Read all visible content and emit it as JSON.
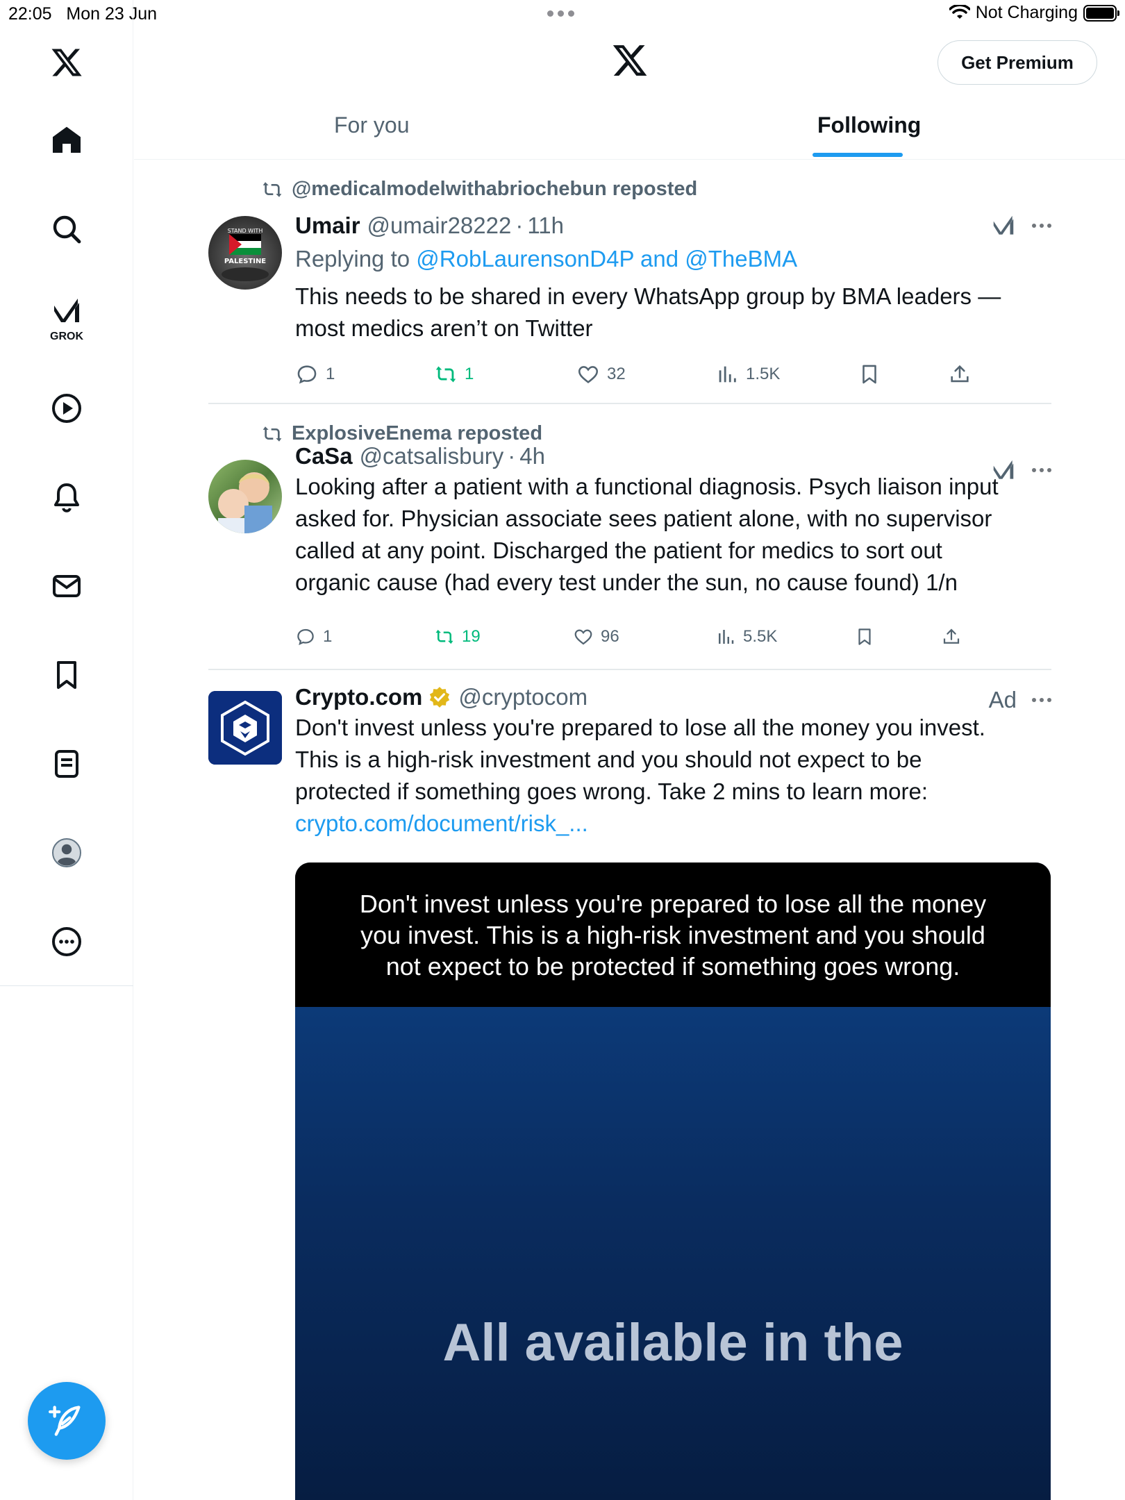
{
  "status_bar": {
    "time": "22:05",
    "date": "Mon 23 Jun",
    "charging": "Not Charging"
  },
  "sidebar": {
    "grok_label": "GROK",
    "icons": [
      "x-logo-icon",
      "home-icon",
      "search-icon",
      "grok-icon",
      "video-icon",
      "notifications-icon",
      "messages-icon",
      "bookmarks-icon",
      "lists-icon",
      "profile-icon",
      "more-icon",
      "compose-icon"
    ]
  },
  "header": {
    "premium_label": "Get Premium",
    "tabs": [
      "For you",
      "Following"
    ],
    "active_tab": "Following"
  },
  "colors": {
    "accent": "#1d9bf0",
    "repost_green": "#00ba7c",
    "text": "#0f1419",
    "muted": "#536471"
  },
  "posts": [
    {
      "repost_by": "@medicalmodelwithabriochebun reposted",
      "name": "Umair",
      "handle": "@umair28222",
      "dot": "·",
      "time": "11h",
      "reply_prefix": "Replying to",
      "reply_mentions": "@RobLaurensonD4P and @TheBMA",
      "text_line1": "This needs to be shared in every WhatsApp group by BMA leaders —",
      "text_line2": "most medics aren’t on Twitter",
      "avatar_text_top": "STAND WITH",
      "avatar_text_bottom": "PALESTINE",
      "stats": {
        "replies": "1",
        "reposts": "1",
        "likes": "32",
        "views": "1.5K"
      }
    },
    {
      "repost_by": "ExplosiveEnema reposted",
      "name": "CaSa",
      "handle": "@catsalisbury",
      "dot": "·",
      "time": "4h",
      "text_line1": "Looking after a patient with a functional diagnosis. Psych liaison input",
      "text_line2": "asked for. Physician associate sees patient alone, with no supervisor",
      "text_line3": "called at any point. Discharged the patient for medics to sort out",
      "text_line4": "organic cause (had every test under the sun, no cause found) 1/n",
      "stats": {
        "replies": "1",
        "reposts": "19",
        "likes": "96",
        "views": "5.5K"
      }
    },
    {
      "name": "Crypto.com",
      "handle": "@cryptocom",
      "ad_label": "Ad",
      "text_line1": "Don't invest unless you're prepared to lose all the money you invest.",
      "text_line2": "This is a high-risk investment and you should not expect to be",
      "text_line3": "protected if something goes wrong. Take 2 mins to learn more:",
      "link": "crypto.com/document/risk_...",
      "media": {
        "top_text_line1": "Don't invest unless you're prepared to lose all the money",
        "top_text_line2": "you invest. This is a high-risk investment and you should",
        "top_text_line3": "not expect to be protected if something goes wrong.",
        "caption": "All available in the"
      }
    }
  ]
}
